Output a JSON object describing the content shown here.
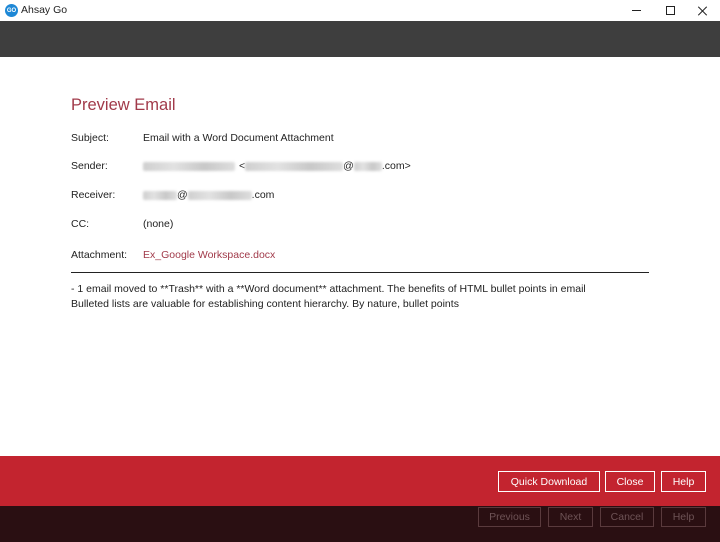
{
  "window": {
    "logo_text": "GO",
    "title": "Ahsay Go"
  },
  "preview": {
    "title": "Preview Email",
    "subject_label": "Subject:",
    "subject_value": "Email with a Word Document Attachment",
    "sender_label": "Sender:",
    "sender_suffix": ".com>",
    "receiver_label": "Receiver:",
    "receiver_suffix": ".com",
    "cc_label": "CC:",
    "cc_value": "(none)",
    "attachment_label": "Attachment:",
    "attachment_value": "Ex_Google Workspace.docx",
    "body_line1": "- 1 email moved to **Trash** with a **Word document** attachment. The benefits of HTML bullet points in email",
    "body_line2": "Bulleted lists are valuable for establishing content hierarchy. By nature, bullet points"
  },
  "footer": {
    "quick_download": "Quick Download",
    "close": "Close",
    "help": "Help"
  },
  "nav": {
    "previous": "Previous",
    "next": "Next",
    "cancel": "Cancel",
    "help": "Help"
  },
  "colors": {
    "accent": "#a13a4a",
    "footer_red": "#c3242f",
    "header_dark": "#3e3e3e",
    "footer_dark": "#2a0f12"
  },
  "icons": [
    "app-logo-icon",
    "minimize-icon",
    "maximize-icon",
    "close-icon"
  ]
}
